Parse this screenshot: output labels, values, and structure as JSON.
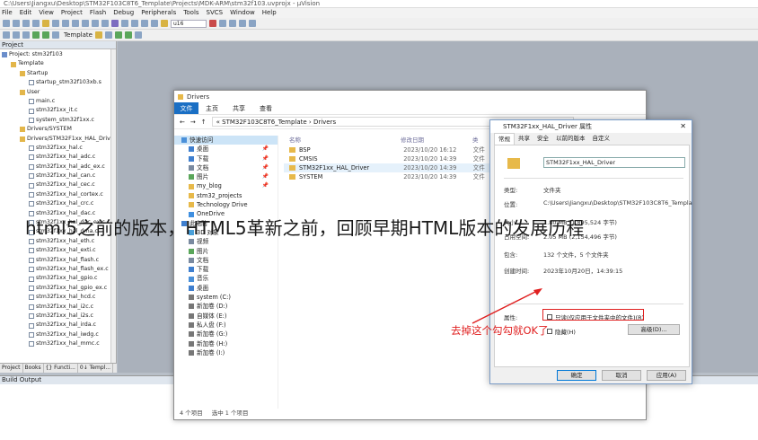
{
  "ide": {
    "title": "C:\\Users\\Jiangxu\\Desktop\\STM32F103C8T6_Template\\Projects\\MDK-ARM\\stm32f103.uvprojx - µVision",
    "menu": [
      "File",
      "Edit",
      "View",
      "Project",
      "Flash",
      "Debug",
      "Peripherals",
      "Tools",
      "SVCS",
      "Window",
      "Help"
    ],
    "toolbar_combo": "u16",
    "target_label": "Template",
    "project_panel_title": "Project",
    "tree": [
      {
        "label": "Project: stm32f103",
        "level": 0,
        "kind": "proj"
      },
      {
        "label": "Template",
        "level": 1,
        "kind": "folder"
      },
      {
        "label": "Startup",
        "level": 2,
        "kind": "folder"
      },
      {
        "label": "startup_stm32f103xb.s",
        "level": 3,
        "kind": "file"
      },
      {
        "label": "User",
        "level": 2,
        "kind": "folder"
      },
      {
        "label": "main.c",
        "level": 3,
        "kind": "file"
      },
      {
        "label": "stm32f1xx_it.c",
        "level": 3,
        "kind": "file"
      },
      {
        "label": "system_stm32f1xx.c",
        "level": 3,
        "kind": "file"
      },
      {
        "label": "Drivers/SYSTEM",
        "level": 2,
        "kind": "folder"
      },
      {
        "label": "Drivers/STM32F1xx_HAL_Driv",
        "level": 2,
        "kind": "folder"
      },
      {
        "label": "stm32f1xx_hal.c",
        "level": 3,
        "kind": "file"
      },
      {
        "label": "stm32f1xx_hal_adc.c",
        "level": 3,
        "kind": "file"
      },
      {
        "label": "stm32f1xx_hal_adc_ex.c",
        "level": 3,
        "kind": "file"
      },
      {
        "label": "stm32f1xx_hal_can.c",
        "level": 3,
        "kind": "file"
      },
      {
        "label": "stm32f1xx_hal_cec.c",
        "level": 3,
        "kind": "file"
      },
      {
        "label": "stm32f1xx_hal_cortex.c",
        "level": 3,
        "kind": "file"
      },
      {
        "label": "stm32f1xx_hal_crc.c",
        "level": 3,
        "kind": "file"
      },
      {
        "label": "stm32f1xx_hal_dac.c",
        "level": 3,
        "kind": "file"
      },
      {
        "label": "stm32f1xx_hal_dac_ex.c",
        "level": 3,
        "kind": "file"
      },
      {
        "label": "stm32f1xx_hal_dma.c",
        "level": 3,
        "kind": "file"
      },
      {
        "label": "stm32f1xx_hal_eth.c",
        "level": 3,
        "kind": "file"
      },
      {
        "label": "stm32f1xx_hal_exti.c",
        "level": 3,
        "kind": "file"
      },
      {
        "label": "stm32f1xx_hal_flash.c",
        "level": 3,
        "kind": "file"
      },
      {
        "label": "stm32f1xx_hal_flash_ex.c",
        "level": 3,
        "kind": "file"
      },
      {
        "label": "stm32f1xx_hal_gpio.c",
        "level": 3,
        "kind": "file"
      },
      {
        "label": "stm32f1xx_hal_gpio_ex.c",
        "level": 3,
        "kind": "file"
      },
      {
        "label": "stm32f1xx_hal_hcd.c",
        "level": 3,
        "kind": "file"
      },
      {
        "label": "stm32f1xx_hal_i2c.c",
        "level": 3,
        "kind": "file"
      },
      {
        "label": "stm32f1xx_hal_i2s.c",
        "level": 3,
        "kind": "file"
      },
      {
        "label": "stm32f1xx_hal_irda.c",
        "level": 3,
        "kind": "file"
      },
      {
        "label": "stm32f1xx_hal_iwdg.c",
        "level": 3,
        "kind": "file"
      },
      {
        "label": "stm32f1xx_hal_mmc.c",
        "level": 3,
        "kind": "file"
      }
    ],
    "panel_tabs": [
      "Project",
      "Books",
      "{} Functi...",
      "0↓ Templ..."
    ],
    "build_output_title": "Build Output"
  },
  "explorer": {
    "title": "Drivers",
    "tabs": [
      "文件",
      "主页",
      "共享",
      "查看"
    ],
    "address": "« STM32F103C8T6_Template › Drivers",
    "nav": [
      {
        "label": "快速访问",
        "icon": "#4a90d9",
        "pin": false,
        "selected": true
      },
      {
        "label": "桌面",
        "icon": "#3f7fcf",
        "pin": true,
        "selected": false
      },
      {
        "label": "下载",
        "icon": "#3f7fcf",
        "pin": true,
        "selected": false
      },
      {
        "label": "文档",
        "icon": "#7a8aa0",
        "pin": true,
        "selected": false
      },
      {
        "label": "图片",
        "icon": "#5aa65a",
        "pin": true,
        "selected": false
      },
      {
        "label": "my_blog",
        "icon": "#e7b94a",
        "pin": true,
        "selected": false
      },
      {
        "label": "stm32_projects",
        "icon": "#e7b94a",
        "pin": false,
        "selected": false
      },
      {
        "label": "Technology Drive",
        "icon": "#e7b94a",
        "pin": false,
        "selected": false
      },
      {
        "label": "OneDrive",
        "icon": "#3f8fe0",
        "pin": false,
        "selected": false
      },
      {
        "label": "此电脑",
        "icon": "#3f7fcf",
        "pin": false,
        "selected": false
      },
      {
        "label": "3D 对象",
        "icon": "#4aa0d9",
        "pin": false,
        "selected": false
      },
      {
        "label": "视频",
        "icon": "#7a8aa0",
        "pin": false,
        "selected": false
      },
      {
        "label": "图片",
        "icon": "#5aa65a",
        "pin": false,
        "selected": false
      },
      {
        "label": "文档",
        "icon": "#7a8aa0",
        "pin": false,
        "selected": false
      },
      {
        "label": "下载",
        "icon": "#3f7fcf",
        "pin": false,
        "selected": false
      },
      {
        "label": "音乐",
        "icon": "#4a90d9",
        "pin": false,
        "selected": false
      },
      {
        "label": "桌面",
        "icon": "#3f7fcf",
        "pin": false,
        "selected": false
      },
      {
        "label": "system (C:)",
        "icon": "#777777",
        "pin": false,
        "selected": false
      },
      {
        "label": "新加卷 (D:)",
        "icon": "#777777",
        "pin": false,
        "selected": false
      },
      {
        "label": "自媒体 (E:)",
        "icon": "#777777",
        "pin": false,
        "selected": false
      },
      {
        "label": "私人盘 (F:)",
        "icon": "#777777",
        "pin": false,
        "selected": false
      },
      {
        "label": "新加卷 (G:)",
        "icon": "#777777",
        "pin": false,
        "selected": false
      },
      {
        "label": "新加卷 (H:)",
        "icon": "#777777",
        "pin": false,
        "selected": false
      },
      {
        "label": "新加卷 (I:)",
        "icon": "#777777",
        "pin": false,
        "selected": false
      }
    ],
    "columns": [
      "名称",
      "修改日期",
      "类"
    ],
    "files": [
      {
        "name": "BSP",
        "date": "2023/10/20 16:12",
        "type": "文件",
        "selected": false
      },
      {
        "name": "CMSIS",
        "date": "2023/10/20 14:39",
        "type": "文件",
        "selected": false
      },
      {
        "name": "STM32F1xx_HAL_Driver",
        "date": "2023/10/20 14:39",
        "type": "文件",
        "selected": true
      },
      {
        "name": "SYSTEM",
        "date": "2023/10/20 14:39",
        "type": "文件",
        "selected": false
      }
    ],
    "status_count": "4 个项目",
    "status_selected": "选中 1 个项目"
  },
  "dialog": {
    "title": "STM32F1xx_HAL_Driver 属性",
    "tabs": [
      "常规",
      "共享",
      "安全",
      "以前的版本",
      "自定义"
    ],
    "folder_name": "STM32F1xx_HAL_Driver",
    "rows": [
      {
        "k": "类型:",
        "v": "文件夹"
      },
      {
        "k": "位置:",
        "v": "C:\\Users\\Jiangxu\\Desktop\\STM32F103C8T6_Templa"
      },
      {
        "k": "大小:",
        "v": "1.80 MB (1,895,524 字节)"
      },
      {
        "k": "占用空间:",
        "v": "2.05 MB (2,154,496 字节)"
      },
      {
        "k": "包含:",
        "v": "132 个文件，5 个文件夹"
      },
      {
        "k": "创建时间:",
        "v": "2023年10月20日，14:39:15"
      }
    ],
    "attributes_label": "属性:",
    "readonly_label": "只读(仅应用于文件夹中的文件)(R)",
    "hidden_label": "隐藏(H)",
    "advanced_label": "高级(D)...",
    "ok": "确定",
    "cancel": "取消",
    "apply": "应用(A)"
  },
  "annotation": "去掉这个勾勾就OK了",
  "overlay_caption": "html5之前的版本，HTML5革新之前，回顾早期HTML版本的发展历程",
  "colors": {
    "explorer_file_tab": "#1a6fc4",
    "annotation_red": "#e02020",
    "folder_yellow": "#e7b94a"
  }
}
